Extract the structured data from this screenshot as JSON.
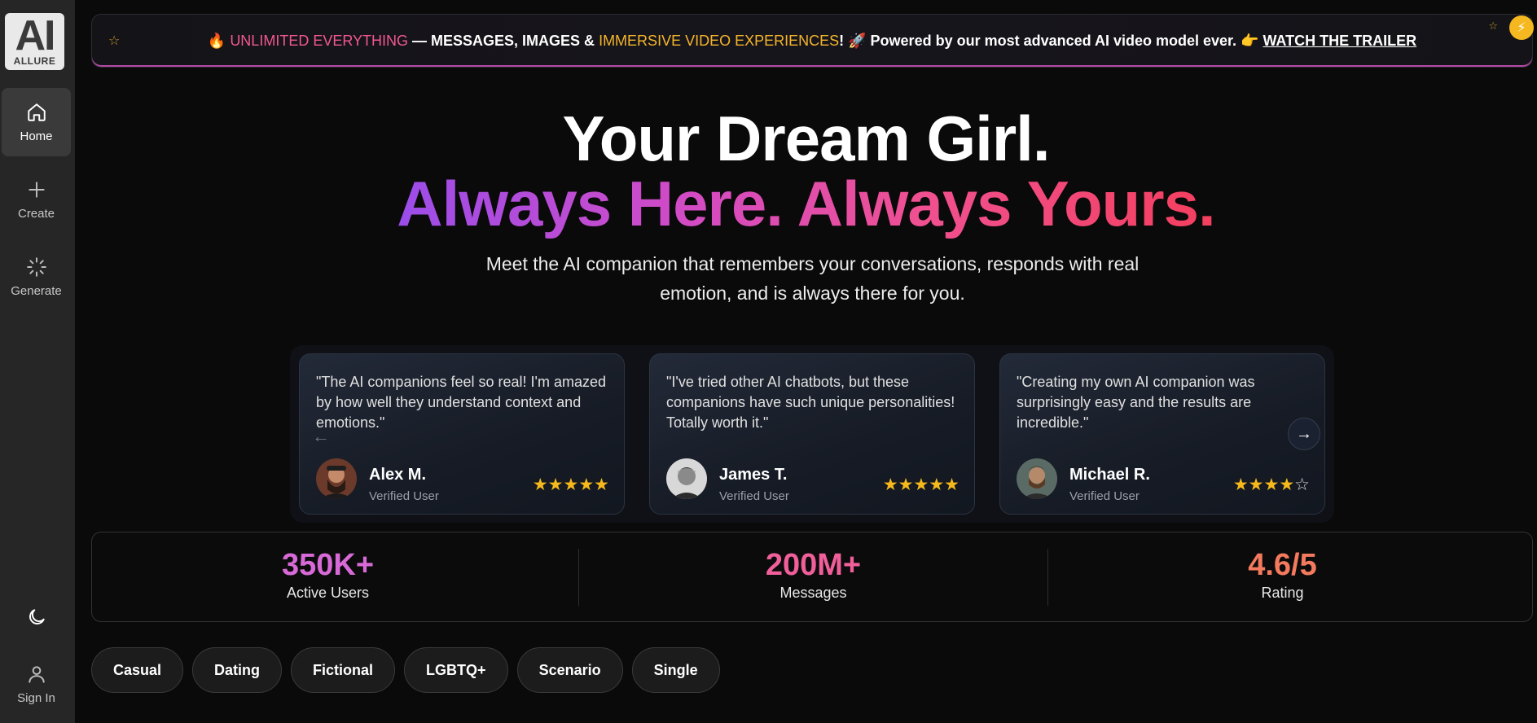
{
  "sidebar": {
    "logo": {
      "mark": "AI",
      "brand": "ALLURE"
    },
    "items": [
      {
        "label": "Home",
        "icon": "home-icon"
      },
      {
        "label": "Create",
        "icon": "plus-icon"
      },
      {
        "label": "Generate",
        "icon": "loader-icon"
      }
    ],
    "bottom": [
      {
        "label": "",
        "icon": "moon-icon"
      },
      {
        "label": "Sign In",
        "icon": "user-icon"
      }
    ]
  },
  "banner": {
    "part1": "UNLIMITED EVERYTHING",
    "part2": " — MESSAGES, IMAGES & ",
    "part3": "IMMERSIVE VIDEO EXPERIENCES",
    "part4": "! 🚀 Powered by our most advanced AI video model ever. 👉 ",
    "link": "WATCH THE TRAILER"
  },
  "hero": {
    "title_line1": "Your Dream Girl.",
    "title_line2": "Always Here. Always Yours.",
    "subtitle": "Meet the AI companion that remembers your conversations, responds with real emotion, and is always there for you."
  },
  "testimonials": [
    {
      "quote": "\"The AI companions feel so real! I'm amazed by how well they understand context and emotions.\"",
      "name": "Alex M.",
      "role": "Verified User",
      "rating": 5
    },
    {
      "quote": "\"I've tried other AI chatbots, but these companions have such unique personalities! Totally worth it.\"",
      "name": "James T.",
      "role": "Verified User",
      "rating": 5
    },
    {
      "quote": "\"Creating my own AI companion was surprisingly easy and the results are incredible.\"",
      "name": "Michael R.",
      "role": "Verified User",
      "rating": 4
    }
  ],
  "stats": [
    {
      "value": "350K+",
      "label": "Active Users",
      "color": "#d86ad8"
    },
    {
      "value": "200M+",
      "label": "Messages",
      "color": "#f05f99"
    },
    {
      "value": "4.6/5",
      "label": "Rating",
      "color": "#f47a5e"
    }
  ],
  "categories": [
    "Casual",
    "Dating",
    "Fictional",
    "LGBTQ+",
    "Scenario",
    "Single"
  ],
  "colors": {
    "accent_pink": "#f2588f",
    "accent_gold": "#f5b52a",
    "star": "#f6b91c"
  }
}
